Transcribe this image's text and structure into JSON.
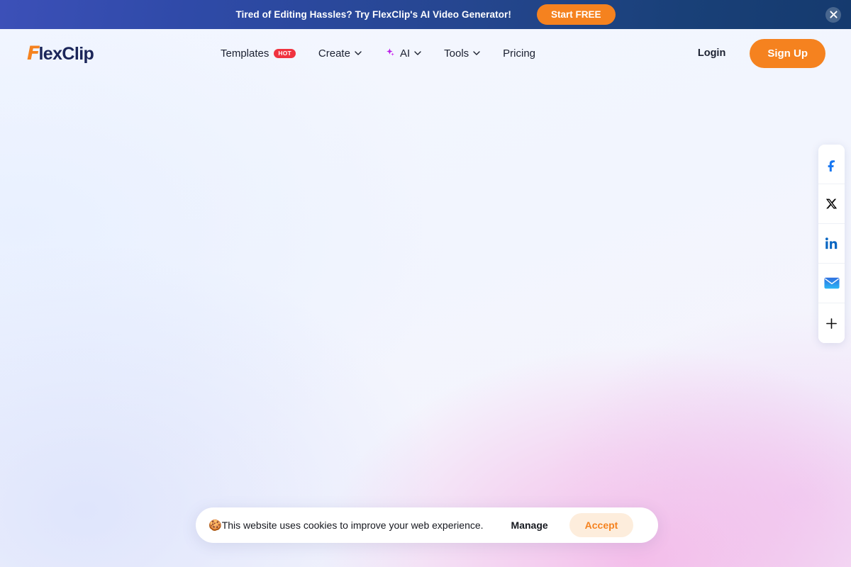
{
  "promo_banner": {
    "message": "Tired of Editing Hassles? Try FlexClip's AI Video Generator!",
    "cta_label": "Start FREE",
    "close_icon": "close-icon",
    "gradient_from": "#3c50b8",
    "gradient_to": "#153a6e",
    "cta_color": "#f5821f"
  },
  "header": {
    "logo": {
      "mark": "F",
      "word": "lexClip",
      "mark_color": "#f5821f",
      "word_color": "#1b2559"
    },
    "nav": [
      {
        "label": "Templates",
        "badge": "HOT",
        "badge_color": "#f0333f",
        "has_chevron": false,
        "icon": null
      },
      {
        "label": "Create",
        "badge": null,
        "has_chevron": true,
        "icon": null
      },
      {
        "label": "AI",
        "badge": null,
        "has_chevron": true,
        "icon": "sparkle-icon"
      },
      {
        "label": "Tools",
        "badge": null,
        "has_chevron": true,
        "icon": null
      },
      {
        "label": "Pricing",
        "badge": null,
        "has_chevron": false,
        "icon": null
      }
    ],
    "login_label": "Login",
    "signup_label": "Sign Up",
    "signup_color": "#f5821f"
  },
  "social_rail": [
    {
      "name": "facebook",
      "icon": "facebook-icon",
      "color": "#1877f2"
    },
    {
      "name": "x-twitter",
      "icon": "x-twitter-icon",
      "color": "#000000"
    },
    {
      "name": "linkedin",
      "icon": "linkedin-icon",
      "color": "#0a66c2"
    },
    {
      "name": "email",
      "icon": "envelope-icon",
      "color": "#2f9cf4"
    },
    {
      "name": "more",
      "icon": "plus-icon",
      "color": "#111111"
    }
  ],
  "cookie_consent": {
    "emoji": "🍪",
    "message": "This website uses cookies to improve your web experience.",
    "manage_label": "Manage",
    "accept_label": "Accept",
    "accept_text_color": "#f5821f",
    "accept_bg_color": "#fdeddc"
  },
  "background": {
    "base_color": "#f3f6ff",
    "glow_pink": "#f3b2e6",
    "glow_blue": "#d6defc"
  }
}
